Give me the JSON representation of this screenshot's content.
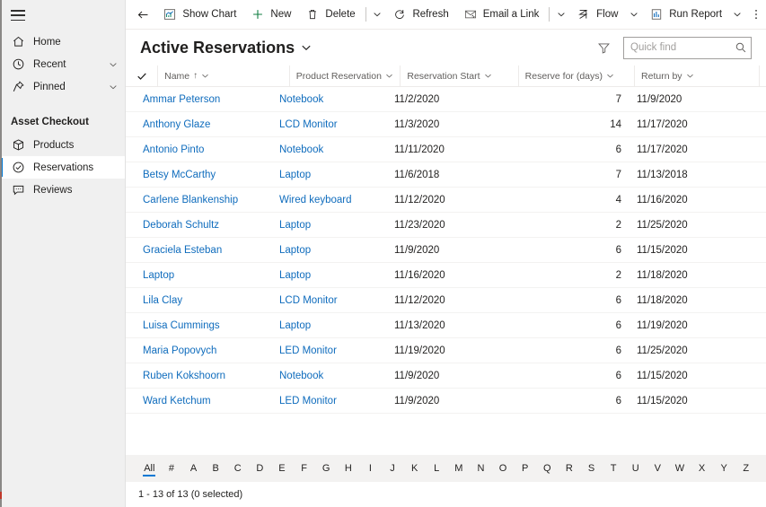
{
  "sidebar": {
    "hamburger_label": "Site Map",
    "top_items": [
      {
        "label": "Home",
        "icon": "home-icon",
        "has_caret": false
      },
      {
        "label": "Recent",
        "icon": "clock-icon",
        "has_caret": true
      },
      {
        "label": "Pinned",
        "icon": "pin-icon",
        "has_caret": true
      }
    ],
    "group_title": "Asset Checkout",
    "group_items": [
      {
        "label": "Products",
        "icon": "box-icon",
        "selected": false
      },
      {
        "label": "Reservations",
        "icon": "check-circle-icon",
        "selected": true
      },
      {
        "label": "Reviews",
        "icon": "comment-icon",
        "selected": false
      }
    ]
  },
  "commandbar": {
    "back_label": "Back",
    "items": [
      {
        "label": "Show Chart",
        "icon": "chart-icon",
        "caret": false
      },
      {
        "label": "New",
        "icon": "plus-icon",
        "caret": false
      },
      {
        "label": "Delete",
        "icon": "trash-icon",
        "caret": true
      },
      {
        "label": "Refresh",
        "icon": "refresh-icon",
        "caret": false
      },
      {
        "label": "Email a Link",
        "icon": "email-link-icon",
        "caret": true
      },
      {
        "label": "Flow",
        "icon": "flow-icon",
        "caret": true
      },
      {
        "label": "Run Report",
        "icon": "report-icon",
        "caret": true
      }
    ],
    "overflow_label": "More commands"
  },
  "view": {
    "title": "Active Reservations",
    "title_caret": "view-selector-chevron-down-icon",
    "filter_icon": "filter-icon"
  },
  "search": {
    "placeholder": "Quick find",
    "value": "",
    "icon": "search-icon"
  },
  "grid": {
    "columns": [
      {
        "label": "Name",
        "sorted": true,
        "sort_arrow": "↑"
      },
      {
        "label": "Product Reservation",
        "sorted": false,
        "sort_arrow": ""
      },
      {
        "label": "Reservation Start",
        "sorted": false,
        "sort_arrow": ""
      },
      {
        "label": "Reserve for (days)",
        "sorted": false,
        "sort_arrow": ""
      },
      {
        "label": "Return by",
        "sorted": false,
        "sort_arrow": ""
      }
    ],
    "rows": [
      {
        "name": "Ammar Peterson",
        "product": "Notebook",
        "start": "11/2/2020",
        "days": "7",
        "return": "11/9/2020"
      },
      {
        "name": "Anthony Glaze",
        "product": "LCD Monitor",
        "start": "11/3/2020",
        "days": "14",
        "return": "11/17/2020"
      },
      {
        "name": "Antonio Pinto",
        "product": "Notebook",
        "start": "11/11/2020",
        "days": "6",
        "return": "11/17/2020"
      },
      {
        "name": "Betsy McCarthy",
        "product": "Laptop",
        "start": "11/6/2018",
        "days": "7",
        "return": "11/13/2018"
      },
      {
        "name": "Carlene Blankenship",
        "product": "Wired keyboard",
        "start": "11/12/2020",
        "days": "4",
        "return": "11/16/2020"
      },
      {
        "name": "Deborah Schultz",
        "product": "Laptop",
        "start": "11/23/2020",
        "days": "2",
        "return": "11/25/2020"
      },
      {
        "name": "Graciela Esteban",
        "product": "Laptop",
        "start": "11/9/2020",
        "days": "6",
        "return": "11/15/2020"
      },
      {
        "name": "Laptop",
        "product": "Laptop",
        "start": "11/16/2020",
        "days": "2",
        "return": "11/18/2020"
      },
      {
        "name": "Lila Clay",
        "product": "LCD Monitor",
        "start": "11/12/2020",
        "days": "6",
        "return": "11/18/2020"
      },
      {
        "name": "Luisa Cummings",
        "product": "Laptop",
        "start": "11/13/2020",
        "days": "6",
        "return": "11/19/2020"
      },
      {
        "name": "Maria Popovych",
        "product": "LED Monitor",
        "start": "11/19/2020",
        "days": "6",
        "return": "11/25/2020"
      },
      {
        "name": "Ruben Kokshoorn",
        "product": "Notebook",
        "start": "11/9/2020",
        "days": "6",
        "return": "11/15/2020"
      },
      {
        "name": "Ward Ketchum",
        "product": "LED Monitor",
        "start": "11/9/2020",
        "days": "6",
        "return": "11/15/2020"
      }
    ]
  },
  "alphabar": {
    "active": "All",
    "items": [
      "All",
      "#",
      "A",
      "B",
      "C",
      "D",
      "E",
      "F",
      "G",
      "H",
      "I",
      "J",
      "K",
      "L",
      "M",
      "N",
      "O",
      "P",
      "Q",
      "R",
      "S",
      "T",
      "U",
      "V",
      "W",
      "X",
      "Y",
      "Z"
    ]
  },
  "status": {
    "record_count": "1 - 13 of 13 (0 selected)"
  },
  "colors": {
    "accent": "#0078d4",
    "link": "#0f6cbd",
    "sidebar_bg": "#f0f0f0",
    "alphabar_bg": "#f3f2f1",
    "new_green": "#107c41",
    "text": "#201f1e"
  }
}
